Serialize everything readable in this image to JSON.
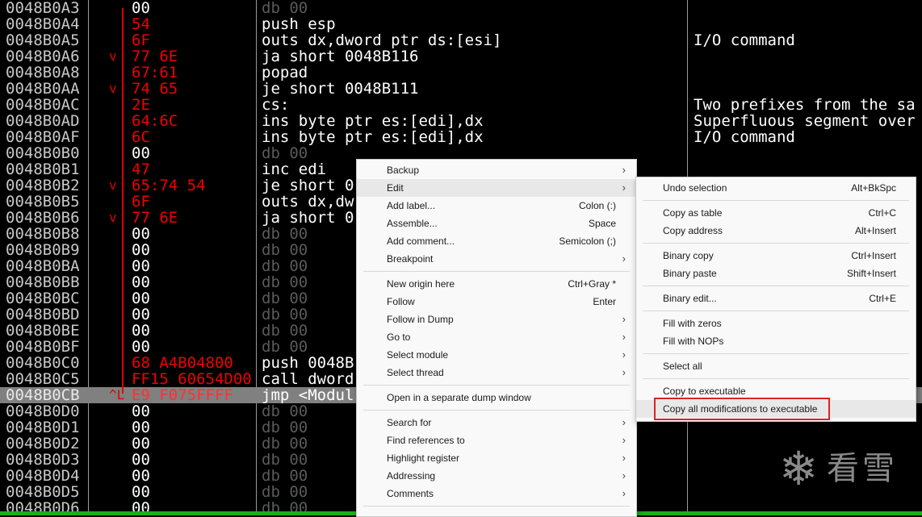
{
  "disasm": {
    "rows": [
      {
        "addr": "0048B0A3",
        "arrow": "",
        "bytes": "00",
        "instr": "db 00",
        "comment": "",
        "dim": true
      },
      {
        "addr": "0048B0A4",
        "arrow": "",
        "bytes": "54",
        "instr": "push esp",
        "comment": "",
        "dim": false
      },
      {
        "addr": "0048B0A5",
        "arrow": "",
        "bytes": "6F",
        "instr": "outs dx,dword ptr ds:[esi]",
        "comment": "I/O command",
        "dim": false
      },
      {
        "addr": "0048B0A6",
        "arrow": "v",
        "bytes": "77 6E",
        "instr": "ja short 0048B116",
        "comment": "",
        "dim": false
      },
      {
        "addr": "0048B0A8",
        "arrow": "",
        "bytes": "67:61",
        "instr": "popad",
        "comment": "",
        "dim": false
      },
      {
        "addr": "0048B0AA",
        "arrow": "v",
        "bytes": "74 65",
        "instr": "je short 0048B111",
        "comment": "",
        "dim": false
      },
      {
        "addr": "0048B0AC",
        "arrow": "",
        "bytes": "2E",
        "instr": "cs:",
        "comment": "Two prefixes from the sa",
        "dim": false
      },
      {
        "addr": "0048B0AD",
        "arrow": "",
        "bytes": "64:6C",
        "instr": "ins byte ptr es:[edi],dx",
        "comment": "Superfluous segment over",
        "dim": false
      },
      {
        "addr": "0048B0AF",
        "arrow": "",
        "bytes": "6C",
        "instr": "ins byte ptr es:[edi],dx",
        "comment": "I/O command",
        "dim": false
      },
      {
        "addr": "0048B0B0",
        "arrow": "",
        "bytes": "00",
        "instr": "db 00",
        "comment": "",
        "dim": true
      },
      {
        "addr": "0048B0B1",
        "arrow": "",
        "bytes": "47",
        "instr": "inc edi",
        "comment": "",
        "dim": false
      },
      {
        "addr": "0048B0B2",
        "arrow": "v",
        "bytes": "65:74 54",
        "instr": "je short 0",
        "comment": "",
        "dim": false
      },
      {
        "addr": "0048B0B5",
        "arrow": "",
        "bytes": "6F",
        "instr": "outs dx,dw",
        "comment": "",
        "dim": false
      },
      {
        "addr": "0048B0B6",
        "arrow": "v",
        "bytes": "77 6E",
        "instr": "ja short 0",
        "comment": "",
        "dim": false
      },
      {
        "addr": "0048B0B8",
        "arrow": "",
        "bytes": "00",
        "instr": "db 00",
        "comment": "",
        "dim": true
      },
      {
        "addr": "0048B0B9",
        "arrow": "",
        "bytes": "00",
        "instr": "db 00",
        "comment": "",
        "dim": true
      },
      {
        "addr": "0048B0BA",
        "arrow": "",
        "bytes": "00",
        "instr": "db 00",
        "comment": "",
        "dim": true
      },
      {
        "addr": "0048B0BB",
        "arrow": "",
        "bytes": "00",
        "instr": "db 00",
        "comment": "",
        "dim": true
      },
      {
        "addr": "0048B0BC",
        "arrow": "",
        "bytes": "00",
        "instr": "db 00",
        "comment": "",
        "dim": true
      },
      {
        "addr": "0048B0BD",
        "arrow": "",
        "bytes": "00",
        "instr": "db 00",
        "comment": "",
        "dim": true
      },
      {
        "addr": "0048B0BE",
        "arrow": "",
        "bytes": "00",
        "instr": "db 00",
        "comment": "",
        "dim": true
      },
      {
        "addr": "0048B0BF",
        "arrow": "",
        "bytes": "00",
        "instr": "db 00",
        "comment": "",
        "dim": true
      },
      {
        "addr": "0048B0C0",
        "arrow": "",
        "bytes": "68 A4B04800",
        "instr": "push 0048B",
        "comment": "",
        "dim": false
      },
      {
        "addr": "0048B0C5",
        "arrow": "",
        "bytes": "FF15 60654D00",
        "instr": "call dword",
        "comment": "",
        "dim": false
      },
      {
        "addr": "0048B0CB",
        "arrow": "^L",
        "bytes": "E9 F075FFFF",
        "instr": "jmp <Modul",
        "comment": "",
        "dim": false,
        "selected": true
      },
      {
        "addr": "0048B0D0",
        "arrow": "",
        "bytes": "00",
        "instr": "db 00",
        "comment": "",
        "dim": true
      },
      {
        "addr": "0048B0D1",
        "arrow": "",
        "bytes": "00",
        "instr": "db 00",
        "comment": "",
        "dim": true
      },
      {
        "addr": "0048B0D2",
        "arrow": "",
        "bytes": "00",
        "instr": "db 00",
        "comment": "",
        "dim": true
      },
      {
        "addr": "0048B0D3",
        "arrow": "",
        "bytes": "00",
        "instr": "db 00",
        "comment": "",
        "dim": true
      },
      {
        "addr": "0048B0D4",
        "arrow": "",
        "bytes": "00",
        "instr": "db 00",
        "comment": "",
        "dim": true
      },
      {
        "addr": "0048B0D5",
        "arrow": "",
        "bytes": "00",
        "instr": "db 00",
        "comment": "",
        "dim": true
      },
      {
        "addr": "0048B0D6",
        "arrow": "",
        "bytes": "00",
        "instr": "db 00",
        "comment": "",
        "dim": true
      }
    ]
  },
  "context_menu": {
    "items": [
      {
        "label": "Backup",
        "shortcut": "",
        "submenu": true
      },
      {
        "label": "Edit",
        "shortcut": "",
        "submenu": true,
        "highlighted": true
      },
      {
        "label": "Add label...",
        "shortcut": "Colon (:)",
        "submenu": false
      },
      {
        "label": "Assemble...",
        "shortcut": "Space",
        "submenu": false
      },
      {
        "label": "Add comment...",
        "shortcut": "Semicolon (;)",
        "submenu": false
      },
      {
        "label": "Breakpoint",
        "shortcut": "",
        "submenu": true,
        "sep_after": true
      },
      {
        "label": "New origin here",
        "shortcut": "Ctrl+Gray *",
        "submenu": false
      },
      {
        "label": "Follow",
        "shortcut": "Enter",
        "submenu": false
      },
      {
        "label": "Follow in Dump",
        "shortcut": "",
        "submenu": true
      },
      {
        "label": "Go to",
        "shortcut": "",
        "submenu": true
      },
      {
        "label": "Select module",
        "shortcut": "",
        "submenu": true
      },
      {
        "label": "Select thread",
        "shortcut": "",
        "submenu": true,
        "sep_after": true
      },
      {
        "label": "Open in a separate dump window",
        "shortcut": "",
        "submenu": false,
        "sep_after": true
      },
      {
        "label": "Search for",
        "shortcut": "",
        "submenu": true
      },
      {
        "label": "Find references to",
        "shortcut": "",
        "submenu": true
      },
      {
        "label": "Highlight register",
        "shortcut": "",
        "submenu": true
      },
      {
        "label": "Addressing",
        "shortcut": "",
        "submenu": true
      },
      {
        "label": "Comments",
        "shortcut": "",
        "submenu": true,
        "sep_after": true
      }
    ]
  },
  "edit_submenu": {
    "items": [
      {
        "label": "Undo selection",
        "shortcut": "Alt+BkSpc",
        "sep_after": true
      },
      {
        "label": "Copy as table",
        "shortcut": "Ctrl+C"
      },
      {
        "label": "Copy address",
        "shortcut": "Alt+Insert",
        "sep_after": true
      },
      {
        "label": "Binary copy",
        "shortcut": "Ctrl+Insert"
      },
      {
        "label": "Binary paste",
        "shortcut": "Shift+Insert",
        "sep_after": true
      },
      {
        "label": "Binary edit...",
        "shortcut": "Ctrl+E",
        "sep_after": true
      },
      {
        "label": "Fill with zeros",
        "shortcut": ""
      },
      {
        "label": "Fill with NOPs",
        "shortcut": "",
        "sep_after": true
      },
      {
        "label": "Select all",
        "shortcut": "",
        "sep_after": true
      },
      {
        "label": "Copy to executable",
        "shortcut": ""
      },
      {
        "label": "Copy all modifications to executable",
        "shortcut": "",
        "highlighted": true,
        "boxed": true
      }
    ]
  },
  "watermark": {
    "icon": "snowflake-icon",
    "text": "看雪"
  },
  "colors": {
    "bytes_red": "#f00000",
    "selection_gray": "#808080",
    "box_red": "#e02020",
    "status_green": "#18b018"
  }
}
